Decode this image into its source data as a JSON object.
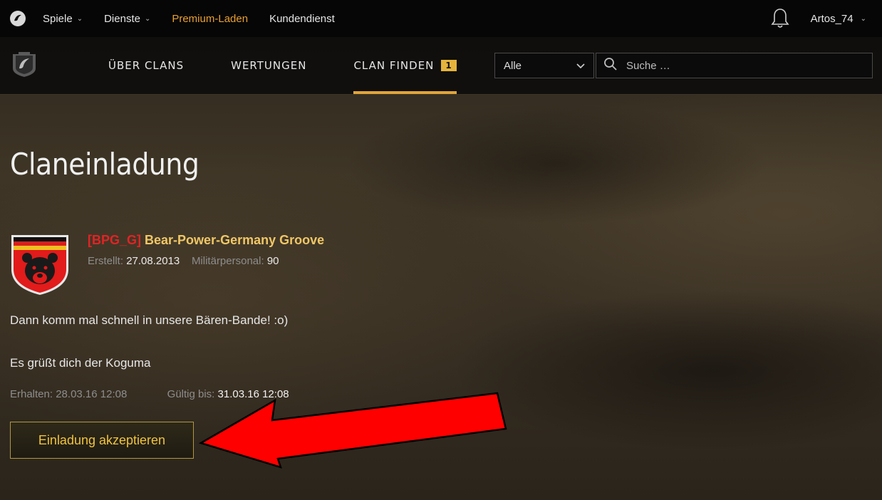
{
  "topbar": {
    "nav": [
      {
        "label": "Spiele",
        "has_dropdown": true
      },
      {
        "label": "Dienste",
        "has_dropdown": true
      },
      {
        "label": "Premium-Laden",
        "has_dropdown": false
      },
      {
        "label": "Kundendienst",
        "has_dropdown": false
      }
    ],
    "username": "Artos_74"
  },
  "clanbar": {
    "tabs": [
      {
        "label": "ÜBER CLANS",
        "active": false
      },
      {
        "label": "WERTUNGEN",
        "active": false
      },
      {
        "label": "CLAN FINDEN",
        "active": true,
        "badge": "1"
      }
    ],
    "filter": {
      "selected": "Alle"
    },
    "search": {
      "placeholder": "Suche …",
      "value": ""
    }
  },
  "invitation": {
    "title": "Claneinladung",
    "clan": {
      "tag": "[BPG_G]",
      "name": "Bear-Power-Germany Groove",
      "created_label": "Erstellt:",
      "created_value": "27.08.2013",
      "members_label": "Militärpersonal:",
      "members_value": "90"
    },
    "message_line1": "Dann komm mal schnell in unsere Bären-Bande! :o)",
    "message_line2": "Es grüßt dich der Koguma",
    "received_label": "Erhalten:",
    "received_value": "28.03.16 12:08",
    "valid_label": "Gültig bis:",
    "valid_value": "31.03.16 12:08",
    "accept_label": "Einladung akzeptieren"
  },
  "colors": {
    "accent": "#e2a53a",
    "premium": "#e8a033",
    "clan_tag": "#e02424",
    "clan_name": "#f0c766",
    "arrow": "#ff0000"
  }
}
